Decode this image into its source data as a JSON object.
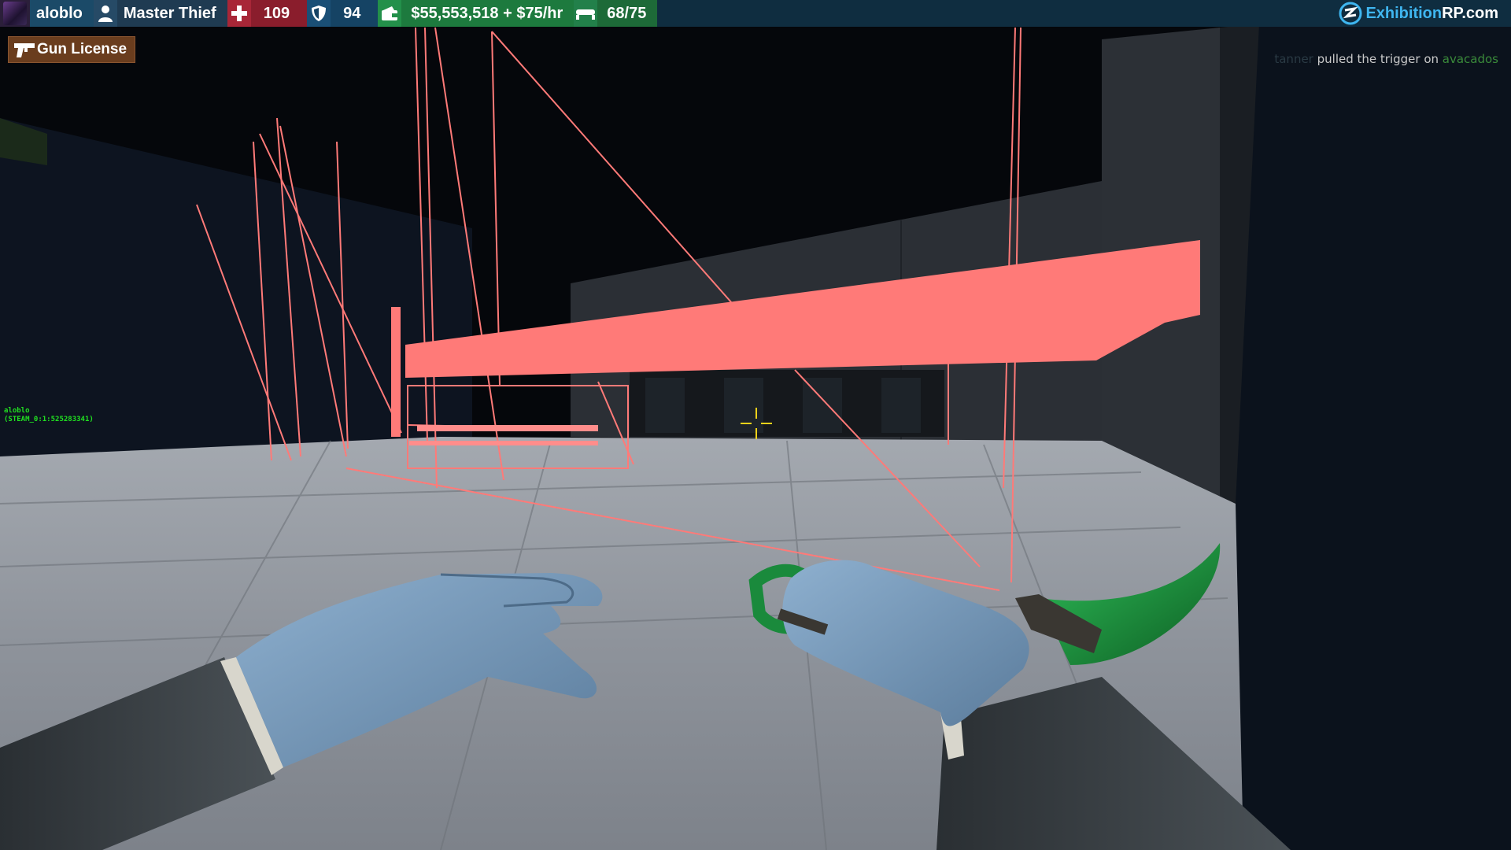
{
  "hud": {
    "player_name": "aloblo",
    "job": "Master Thief",
    "health": "109",
    "armor": "94",
    "money": "$55,553,518 + $75/hr",
    "hunger": "68/75",
    "brand_part1": "Exhibition",
    "brand_part2": "RP.com"
  },
  "license": {
    "label": "Gun License"
  },
  "killfeed": {
    "attacker": "tanner",
    "action": "pulled the trigger on",
    "victim": "avacados"
  },
  "player_tag": {
    "name": "aloblo",
    "steam_id": "(STEAM_0:1:525283341)"
  },
  "icons": {
    "avatar": "player-avatar",
    "job": "person-icon",
    "health": "health-cross-icon",
    "armor": "shield-icon",
    "money": "wallet-icon",
    "hunger": "food-icon",
    "brand": "brand-logo-icon",
    "license": "pistol-icon",
    "crosshair": "crosshair-icon"
  },
  "colors": {
    "hud_bar": "#0f2d40",
    "health": "#8a1d2c",
    "armor": "#154364",
    "money": "#1d7a3e",
    "license": "#6a3d1e",
    "brand_accent": "#3fb6f0",
    "zone_highlight": "#ff7a78",
    "crosshair": "#f2d21a",
    "knife_blade": "#1d8a3a"
  }
}
